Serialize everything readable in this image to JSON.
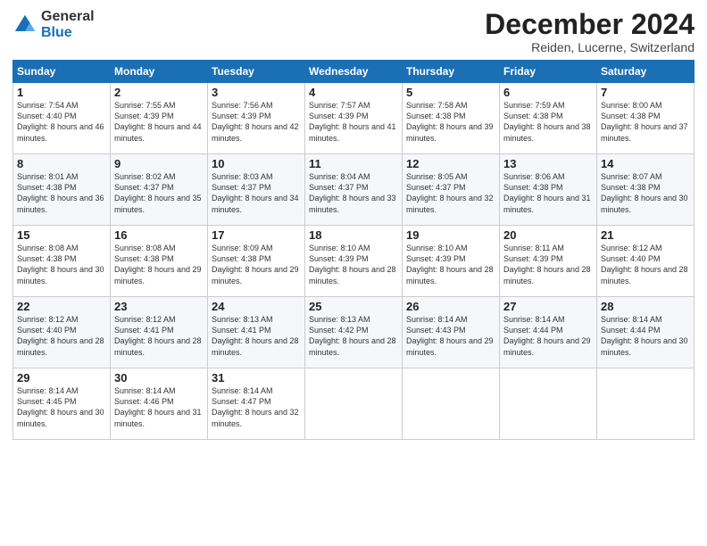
{
  "logo": {
    "general": "General",
    "blue": "Blue"
  },
  "title": "December 2024",
  "location": "Reiden, Lucerne, Switzerland",
  "days_of_week": [
    "Sunday",
    "Monday",
    "Tuesday",
    "Wednesday",
    "Thursday",
    "Friday",
    "Saturday"
  ],
  "weeks": [
    [
      {
        "day": "1",
        "sunrise": "Sunrise: 7:54 AM",
        "sunset": "Sunset: 4:40 PM",
        "daylight": "Daylight: 8 hours and 46 minutes."
      },
      {
        "day": "2",
        "sunrise": "Sunrise: 7:55 AM",
        "sunset": "Sunset: 4:39 PM",
        "daylight": "Daylight: 8 hours and 44 minutes."
      },
      {
        "day": "3",
        "sunrise": "Sunrise: 7:56 AM",
        "sunset": "Sunset: 4:39 PM",
        "daylight": "Daylight: 8 hours and 42 minutes."
      },
      {
        "day": "4",
        "sunrise": "Sunrise: 7:57 AM",
        "sunset": "Sunset: 4:39 PM",
        "daylight": "Daylight: 8 hours and 41 minutes."
      },
      {
        "day": "5",
        "sunrise": "Sunrise: 7:58 AM",
        "sunset": "Sunset: 4:38 PM",
        "daylight": "Daylight: 8 hours and 39 minutes."
      },
      {
        "day": "6",
        "sunrise": "Sunrise: 7:59 AM",
        "sunset": "Sunset: 4:38 PM",
        "daylight": "Daylight: 8 hours and 38 minutes."
      },
      {
        "day": "7",
        "sunrise": "Sunrise: 8:00 AM",
        "sunset": "Sunset: 4:38 PM",
        "daylight": "Daylight: 8 hours and 37 minutes."
      }
    ],
    [
      {
        "day": "8",
        "sunrise": "Sunrise: 8:01 AM",
        "sunset": "Sunset: 4:38 PM",
        "daylight": "Daylight: 8 hours and 36 minutes."
      },
      {
        "day": "9",
        "sunrise": "Sunrise: 8:02 AM",
        "sunset": "Sunset: 4:37 PM",
        "daylight": "Daylight: 8 hours and 35 minutes."
      },
      {
        "day": "10",
        "sunrise": "Sunrise: 8:03 AM",
        "sunset": "Sunset: 4:37 PM",
        "daylight": "Daylight: 8 hours and 34 minutes."
      },
      {
        "day": "11",
        "sunrise": "Sunrise: 8:04 AM",
        "sunset": "Sunset: 4:37 PM",
        "daylight": "Daylight: 8 hours and 33 minutes."
      },
      {
        "day": "12",
        "sunrise": "Sunrise: 8:05 AM",
        "sunset": "Sunset: 4:37 PM",
        "daylight": "Daylight: 8 hours and 32 minutes."
      },
      {
        "day": "13",
        "sunrise": "Sunrise: 8:06 AM",
        "sunset": "Sunset: 4:38 PM",
        "daylight": "Daylight: 8 hours and 31 minutes."
      },
      {
        "day": "14",
        "sunrise": "Sunrise: 8:07 AM",
        "sunset": "Sunset: 4:38 PM",
        "daylight": "Daylight: 8 hours and 30 minutes."
      }
    ],
    [
      {
        "day": "15",
        "sunrise": "Sunrise: 8:08 AM",
        "sunset": "Sunset: 4:38 PM",
        "daylight": "Daylight: 8 hours and 30 minutes."
      },
      {
        "day": "16",
        "sunrise": "Sunrise: 8:08 AM",
        "sunset": "Sunset: 4:38 PM",
        "daylight": "Daylight: 8 hours and 29 minutes."
      },
      {
        "day": "17",
        "sunrise": "Sunrise: 8:09 AM",
        "sunset": "Sunset: 4:38 PM",
        "daylight": "Daylight: 8 hours and 29 minutes."
      },
      {
        "day": "18",
        "sunrise": "Sunrise: 8:10 AM",
        "sunset": "Sunset: 4:39 PM",
        "daylight": "Daylight: 8 hours and 28 minutes."
      },
      {
        "day": "19",
        "sunrise": "Sunrise: 8:10 AM",
        "sunset": "Sunset: 4:39 PM",
        "daylight": "Daylight: 8 hours and 28 minutes."
      },
      {
        "day": "20",
        "sunrise": "Sunrise: 8:11 AM",
        "sunset": "Sunset: 4:39 PM",
        "daylight": "Daylight: 8 hours and 28 minutes."
      },
      {
        "day": "21",
        "sunrise": "Sunrise: 8:12 AM",
        "sunset": "Sunset: 4:40 PM",
        "daylight": "Daylight: 8 hours and 28 minutes."
      }
    ],
    [
      {
        "day": "22",
        "sunrise": "Sunrise: 8:12 AM",
        "sunset": "Sunset: 4:40 PM",
        "daylight": "Daylight: 8 hours and 28 minutes."
      },
      {
        "day": "23",
        "sunrise": "Sunrise: 8:12 AM",
        "sunset": "Sunset: 4:41 PM",
        "daylight": "Daylight: 8 hours and 28 minutes."
      },
      {
        "day": "24",
        "sunrise": "Sunrise: 8:13 AM",
        "sunset": "Sunset: 4:41 PM",
        "daylight": "Daylight: 8 hours and 28 minutes."
      },
      {
        "day": "25",
        "sunrise": "Sunrise: 8:13 AM",
        "sunset": "Sunset: 4:42 PM",
        "daylight": "Daylight: 8 hours and 28 minutes."
      },
      {
        "day": "26",
        "sunrise": "Sunrise: 8:14 AM",
        "sunset": "Sunset: 4:43 PM",
        "daylight": "Daylight: 8 hours and 29 minutes."
      },
      {
        "day": "27",
        "sunrise": "Sunrise: 8:14 AM",
        "sunset": "Sunset: 4:44 PM",
        "daylight": "Daylight: 8 hours and 29 minutes."
      },
      {
        "day": "28",
        "sunrise": "Sunrise: 8:14 AM",
        "sunset": "Sunset: 4:44 PM",
        "daylight": "Daylight: 8 hours and 30 minutes."
      }
    ],
    [
      {
        "day": "29",
        "sunrise": "Sunrise: 8:14 AM",
        "sunset": "Sunset: 4:45 PM",
        "daylight": "Daylight: 8 hours and 30 minutes."
      },
      {
        "day": "30",
        "sunrise": "Sunrise: 8:14 AM",
        "sunset": "Sunset: 4:46 PM",
        "daylight": "Daylight: 8 hours and 31 minutes."
      },
      {
        "day": "31",
        "sunrise": "Sunrise: 8:14 AM",
        "sunset": "Sunset: 4:47 PM",
        "daylight": "Daylight: 8 hours and 32 minutes."
      },
      null,
      null,
      null,
      null
    ]
  ]
}
